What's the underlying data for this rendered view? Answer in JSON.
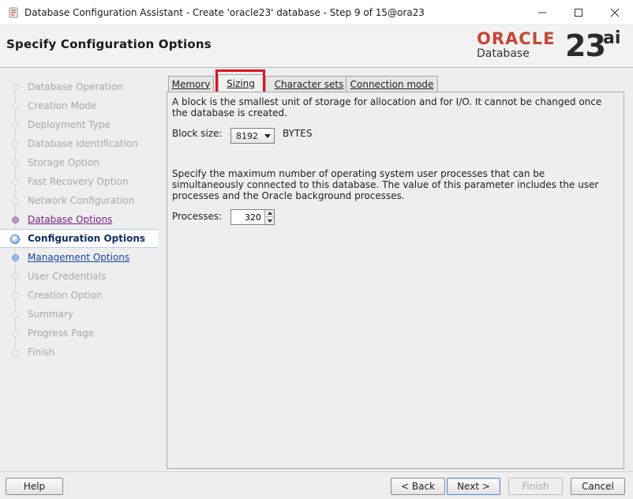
{
  "window": {
    "title": "Database Configuration Assistant - Create 'oracle23' database - Step 9 of 15@ora23",
    "controls": [
      "minimize-icon",
      "maximize-icon",
      "close-icon"
    ]
  },
  "header": {
    "page_title": "Specify Configuration Options",
    "logo": {
      "brand": "ORACLE",
      "product": "Database",
      "version": "23",
      "suffix": "ai"
    }
  },
  "sidebar": {
    "steps": [
      {
        "label": "Database Operation",
        "state": "done"
      },
      {
        "label": "Creation Mode",
        "state": "done"
      },
      {
        "label": "Deployment Type",
        "state": "done"
      },
      {
        "label": "Database Identification",
        "state": "done"
      },
      {
        "label": "Storage Option",
        "state": "done"
      },
      {
        "label": "Fast Recovery Option",
        "state": "done"
      },
      {
        "label": "Network Configuration",
        "state": "done"
      },
      {
        "label": "Database Options",
        "state": "visited"
      },
      {
        "label": "Configuration Options",
        "state": "current"
      },
      {
        "label": "Management Options",
        "state": "link"
      },
      {
        "label": "User Credentials",
        "state": "pending"
      },
      {
        "label": "Creation Option",
        "state": "pending"
      },
      {
        "label": "Summary",
        "state": "pending"
      },
      {
        "label": "Progress Page",
        "state": "pending"
      },
      {
        "label": "Finish",
        "state": "pending"
      }
    ]
  },
  "tabs": [
    {
      "label": "Memory",
      "active": false
    },
    {
      "label": "Sizing",
      "active": true
    },
    {
      "label": "Character sets",
      "active": false
    },
    {
      "label": "Connection mode",
      "active": false
    }
  ],
  "sizing": {
    "block_desc": "A block is the smallest unit of storage for allocation and for I/O. It cannot be changed once the database is created.",
    "block_size_label": "Block size:",
    "block_size_value": "8192",
    "block_size_unit": "BYTES",
    "processes_desc": "Specify the maximum number of operating system user processes that can be simultaneously connected to this database. The value of this parameter includes the user processes and the Oracle background processes.",
    "processes_label": "Processes:",
    "processes_value": "320"
  },
  "footer": {
    "help": "Help",
    "back": "< Back",
    "next": "Next >",
    "finish": "Finish",
    "cancel": "Cancel"
  },
  "colors": {
    "highlight": "#e1141e",
    "oracle_red": "#c74634",
    "link": "#1a45a5",
    "visited": "#7a1f86"
  }
}
